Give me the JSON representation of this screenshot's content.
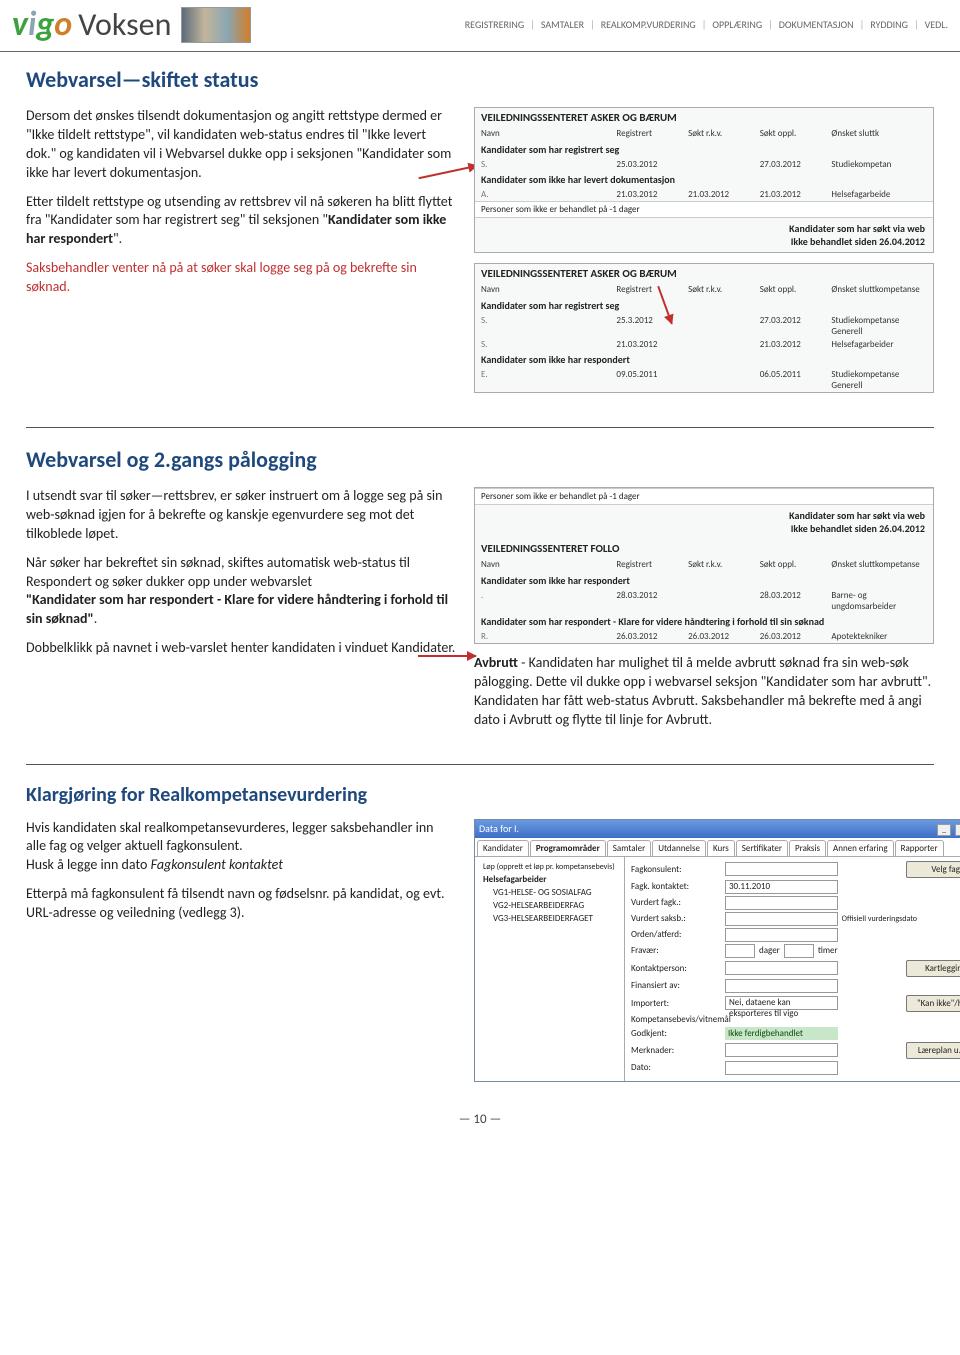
{
  "header": {
    "logo": "Voksen",
    "nav": [
      "REGISTRERING",
      "SAMTALER",
      "REALKOMP.VURDERING",
      "OPPLÆRING",
      "DOKUMENTASJON",
      "RYDDING",
      "VEDL."
    ]
  },
  "section1": {
    "title": "Webvarsel—skiftet status",
    "p1": "Dersom det ønskes tilsendt dokumentasjon og angitt rettstype dermed er \"Ikke tildelt rettstype\", vil kandidaten web-status endres til \"Ikke levert dok.\" og kandidaten vil i Webvarsel dukke opp i seksjonen \"Kandidater som ikke har levert dokumentasjon.",
    "p2a": "Etter tildelt rettstype og utsending av rettsbrev vil nå søkeren ha blitt flyttet fra \"Kandidater som har registrert seg\" til  seksjonen \"",
    "p2bold": "Kandidater som ikke har respondert",
    "p2b": "\".",
    "p3": "Saksbehandler venter nå på at søker skal logge seg på og bekrefte sin søknad.",
    "fig1": {
      "title": "VEILEDNINGSSENTERET ASKER OG BÆRUM",
      "heads": [
        "Navn",
        "Registrert",
        "Søkt r.k.v.",
        "Søkt oppl.",
        "Ønsket sluttk"
      ],
      "g1": "Kandidater som har registrert seg",
      "r1": [
        "S.",
        "25.03.2012",
        "",
        "27.03.2012",
        "Studiekompetan"
      ],
      "g2": "Kandidater som ikke har levert dokumentasjon",
      "r2": [
        "A.",
        "21.03.2012",
        "21.03.2012",
        "21.03.2012",
        "Helsefagarbeide"
      ],
      "noteLine": "Personer som ikke er behandlet på -1 dager",
      "rightLine1": "Kandidater som har søkt via web",
      "rightLine2": "Ikke behandlet siden 26.04.2012"
    },
    "fig2": {
      "title": "VEILEDNINGSSENTERET ASKER OG BÆRUM",
      "heads": [
        "Navn",
        "Registrert",
        "Søkt r.k.v.",
        "Søkt oppl.",
        "Ønsket sluttkompetanse"
      ],
      "g1": "Kandidater som har registrert seg",
      "r1": [
        "S.",
        "25.3.2012",
        "",
        "27.03.2012",
        "Studiekompetanse Generell"
      ],
      "r2": [
        "S.",
        "21.03.2012",
        "",
        "21.03.2012",
        "Helsefagarbeider"
      ],
      "g2": "Kandidater som ikke har respondert",
      "r3": [
        "E.",
        "09.05.2011",
        "",
        "06.05.2011",
        "Studiekompetanse Generell"
      ]
    }
  },
  "section2": {
    "title": "Webvarsel og 2.gangs pålogging",
    "p1": "I utsendt svar til søker—rettsbrev, er søker instruert om å logge seg på sin web-søknad igjen for å bekrefte og kanskje egenvurdere seg mot det tilkoblede løpet.",
    "p2a": "Når søker har bekreftet sin søknad, skiftes automatisk web-status til Respondert og søker dukker opp under webvarslet",
    "p2bold": "\"Kandidater som har respondert - Klare for videre håndtering i forhold til sin søknad\"",
    "p2b": ".",
    "p3": "Dobbelklikk på navnet i web-varslet henter kandidaten i vinduet Kandidater.",
    "noteBold": "Avbrutt",
    "note": " - Kandidaten har mulighet til å melde avbrutt søknad fra sin web-søk pålogging. Dette vil dukke opp i webvarsel seksjon \"Kandidater som har avbrutt\". Kandidaten har fått web-status Avbrutt. Saksbehandler må bekrefte med å angi dato i Avbrutt og flytte til linje for Avbrutt.",
    "fig": {
      "noteLine": "Personer som ikke er behandlet på -1 dager",
      "rightLine1": "Kandidater som har søkt via web",
      "rightLine2": "Ikke behandlet siden 26.04.2012",
      "title": "VEILEDNINGSSENTERET FOLLO",
      "heads": [
        "Navn",
        "Registrert",
        "Søkt r.k.v.",
        "Søkt oppl.",
        "Ønsket sluttkompetanse"
      ],
      "g1": "Kandidater som ikke har respondert",
      "r1": [
        ".",
        "28.03.2012",
        "",
        "28.03.2012",
        "Barne- og ungdomsarbeider"
      ],
      "g2": "Kandidater som har respondert - Klare for videre håndtering i forhold til sin søknad",
      "r2": [
        "R.",
        "26.03.2012",
        "26.03.2012",
        "26.03.2012",
        "Apotektekniker"
      ]
    }
  },
  "section3": {
    "title": "Klargjøring for Realkompetansevurdering",
    "p1a": "Hvis kandidaten skal realkompetansevurderes, legger saksbehandler inn alle fag og velger aktuell fagkonsulent.",
    "p1b": "Husk å legge inn dato ",
    "p1italic": "Fagkonsulent kontaktet",
    "p2": "Etterpå må fagkonsulent få tilsendt navn og fødselsnr. på kandidat, og evt. URL-adresse og veiledning (vedlegg 3).",
    "win": {
      "title": "Data for I.",
      "tabs": [
        "Kandidater",
        "Programområder",
        "Samtaler",
        "Utdannelse",
        "Kurs",
        "Sertifikater",
        "Praksis",
        "Annen erfaring",
        "Rapporter"
      ],
      "treeHead": "Løp (opprett et løp pr. kompetansebevis)",
      "tree": [
        "Helsefagarbeider",
        "VG1-HELSE- OG SOSIALFAG",
        "VG2-HELSEARBEIDERFAG",
        "VG3-HELSEARBEIDERFAGET"
      ],
      "labels": {
        "fagkonsulent": "Fagkonsulent:",
        "fagkKontaktet": "Fagk. kontaktet:",
        "vurdertFagk": "Vurdert fagk.:",
        "vurdertSaksb": "Vurdert saksb.:",
        "offVurd": "Offisiell vurderingsdato",
        "orden": "Orden/atferd:",
        "fravaer": "Fravær:",
        "dager": "dager",
        "timer": "timer",
        "kontaktperson": "Kontaktperson:",
        "finansiert": "Finansiert av:",
        "importert": "Importert:",
        "importertVal": "Nei, dataene kan eksporteres til vigo",
        "kompbevis": "Kompetansebevis/vitnemål",
        "godkjent": "Godkjent:",
        "godkjVal": "Ikke ferdigbehandlet",
        "merknader": "Merknader:",
        "dato": "Dato:"
      },
      "dateVal": "30.11.2010",
      "btns": {
        "velgFag": "Velg fag",
        "kartlegging": "Kartlegging",
        "kanIkke": "\"Kan ikke\"/h.m.",
        "laereplan": "Læreplan u. sp."
      }
    }
  },
  "pageNumber": "— 10 —"
}
